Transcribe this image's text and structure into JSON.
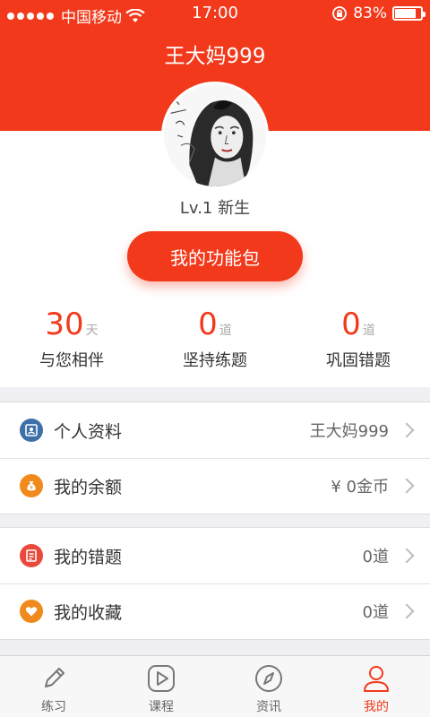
{
  "status_bar": {
    "carrier": "中国移动",
    "time": "17:00",
    "battery": "83%",
    "battery_level": 0.83
  },
  "header": {
    "title": "王大妈999"
  },
  "profile": {
    "level": "Lv.1  新生",
    "function_pack_button": "我的功能包"
  },
  "stats": [
    {
      "value": "30",
      "unit": "天",
      "label": "与您相伴"
    },
    {
      "value": "0",
      "unit": "道",
      "label": "坚持练题"
    },
    {
      "value": "0",
      "unit": "道",
      "label": "巩固错题"
    }
  ],
  "menu": {
    "group1": [
      {
        "label": "个人资料",
        "value": "王大妈999",
        "icon": "profile-card-icon",
        "color": "#3e6fa8"
      },
      {
        "label": "我的余额",
        "value": "¥ 0金币",
        "icon": "money-bag-icon",
        "color": "#f08a1c"
      }
    ],
    "group2": [
      {
        "label": "我的错题",
        "value": "0道",
        "icon": "wrong-question-icon",
        "color": "#e8493a"
      },
      {
        "label": "我的收藏",
        "value": "0道",
        "icon": "heart-icon",
        "color": "#f08a1c"
      }
    ]
  },
  "tabs": [
    {
      "label": "练习",
      "icon": "pencil-icon"
    },
    {
      "label": "课程",
      "icon": "play-icon"
    },
    {
      "label": "资讯",
      "icon": "compass-icon"
    },
    {
      "label": "我的",
      "icon": "person-icon",
      "active": true
    }
  ],
  "colors": {
    "accent": "#f2391b"
  }
}
